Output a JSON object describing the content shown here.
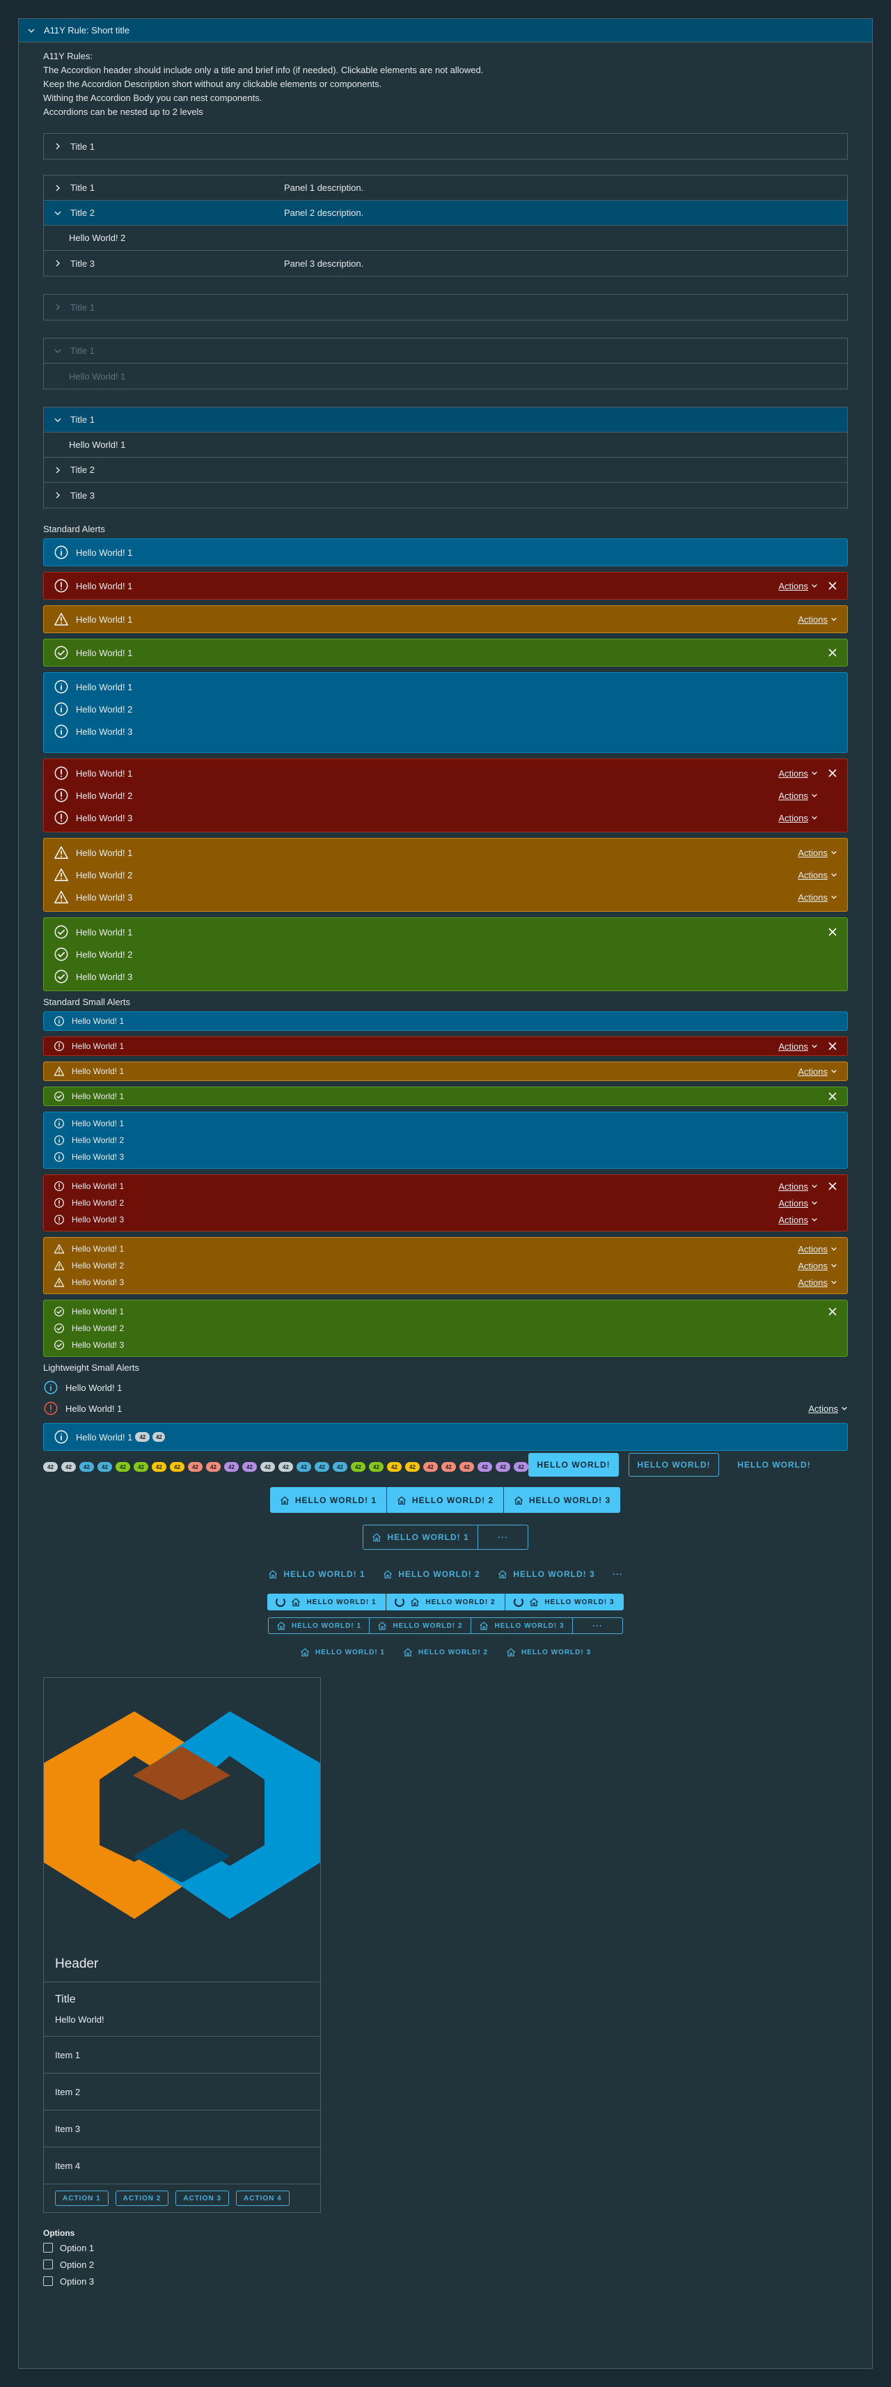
{
  "outer": {
    "title": "A11Y Rule: Short title"
  },
  "rules": [
    "A11Y Rules:",
    "The Accordion header should include only a title and brief info (if needed). Clickable elements are not allowed.",
    "Keep the Accordion Description short without any clickable elements or components.",
    "Withing the Accordion Body you can nest components.",
    "Accordions can be nested up to 2 levels"
  ],
  "acc1": {
    "title": "Title 1"
  },
  "acc2": {
    "items": [
      {
        "title": "Title 1",
        "desc": "Panel 1 description."
      },
      {
        "title": "Title 2",
        "desc": "Panel 2 description."
      },
      {
        "title": "Title 3",
        "desc": "Panel 3 description."
      }
    ],
    "body": "Hello World! 2"
  },
  "acc3": {
    "title": "Title 1"
  },
  "acc4": {
    "title": "Title 1",
    "body": "Hello World! 1"
  },
  "acc5": {
    "t1": "Title 1",
    "body": "Hello World! 1",
    "t2": "Title 2",
    "t3": "Title 3"
  },
  "sections": {
    "standard": "Standard Alerts",
    "small": "Standard Small Alerts",
    "lightweight": "Lightweight Small Alerts"
  },
  "alert": {
    "l1": "Hello World! 1",
    "l2": "Hello World! 2",
    "l3": "Hello World! 3",
    "actions": "Actions"
  },
  "badges": {
    "items": [
      "42",
      "42",
      "42",
      "42",
      "42",
      "42",
      "42",
      "42",
      "42",
      "42",
      "42",
      "42",
      "42",
      "42",
      "42",
      "42",
      "42",
      "42",
      "42",
      "42",
      "42",
      "42",
      "42",
      "42",
      "42",
      "42",
      "42",
      "42",
      "42"
    ],
    "colors": [
      "#c7d0d5",
      "#c7d0d5",
      "#49afd9",
      "#49afd9",
      "#85c81a",
      "#85c81a",
      "#fac400",
      "#fac400",
      "#f38b78",
      "#f38b78",
      "#b58ee3",
      "#b58ee3",
      "#c7d0d5",
      "#c7d0d5",
      "#49afd9",
      "#49afd9",
      "#49afd9",
      "#85c81a",
      "#85c81a",
      "#fac400",
      "#fac400",
      "#f38b78",
      "#f38b78",
      "#f38b78",
      "#b58ee3",
      "#b58ee3",
      "#b58ee3"
    ],
    "inline": "42"
  },
  "buttons": {
    "hw": "HELLO WORLD!",
    "hw1": "HELLO WORLD! 1",
    "hw2": "HELLO WORLD! 2",
    "hw3": "HELLO WORLD! 3",
    "more": "···"
  },
  "card": {
    "header": "Header",
    "title": "Title",
    "text": "Hello World!",
    "items": [
      "Item 1",
      "Item 2",
      "Item 3",
      "Item 4"
    ],
    "actions": [
      "ACTION 1",
      "ACTION 2",
      "ACTION 3",
      "ACTION 4"
    ]
  },
  "options": {
    "label": "Options",
    "items": [
      "Option 1",
      "Option 2",
      "Option 3"
    ]
  },
  "colors": {
    "info": "#00608c",
    "danger": "#6e0f08",
    "warning": "#8c5800",
    "success": "#3a6c10",
    "accent": "#49c5f6",
    "orange": "#f08b0a",
    "blue": "#0095d3"
  }
}
